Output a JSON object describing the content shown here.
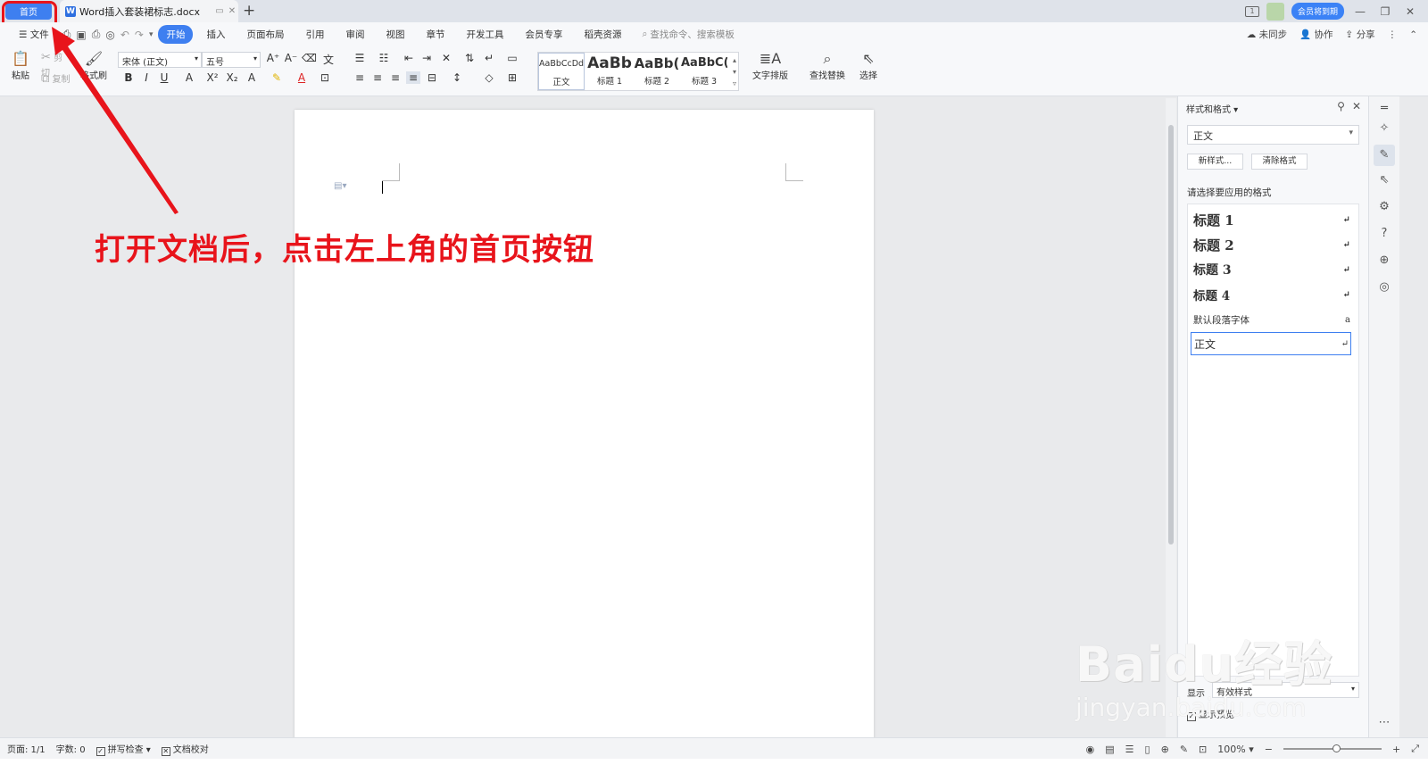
{
  "titlebar": {
    "home_tab": "首页",
    "doc_tab": "Word插入套装裙标志.docx",
    "member_badge": "会员将到期"
  },
  "menu": {
    "file": "文件",
    "tabs": [
      "开始",
      "插入",
      "页面布局",
      "引用",
      "审阅",
      "视图",
      "章节",
      "开发工具",
      "会员专享",
      "稻壳资源"
    ],
    "active_tab": "开始",
    "search_placeholder": "查找命令、搜索模板",
    "right": [
      "未同步",
      "协作",
      "分享"
    ]
  },
  "toolbar": {
    "paste": "粘贴",
    "cut": "剪切",
    "copy": "复制",
    "format_painter": "格式刷",
    "font": "宋体 (正文)",
    "size": "五号",
    "styles": [
      {
        "sample": "AaBbCcDd",
        "name": "正文"
      },
      {
        "sample": "AaBb",
        "name": "标题 1"
      },
      {
        "sample": "AaBb(",
        "name": "标题 2"
      },
      {
        "sample": "AaBbC(",
        "name": "标题 3"
      }
    ],
    "text_layout": "文字排版",
    "find_replace": "查找替换",
    "select": "选择"
  },
  "annotation": "打开文档后，点击左上角的首页按钮",
  "panel": {
    "title": "样式和格式",
    "current_style": "正文",
    "new_style": "新样式...",
    "clear_format": "清除格式",
    "hint": "请选择要应用的格式",
    "items": [
      "标题 1",
      "标题 2",
      "标题 3",
      "标题 4",
      "默认段落字体",
      "正文"
    ],
    "show_label": "显示",
    "show_value": "有效样式",
    "preview": "显示预览"
  },
  "status": {
    "page": "页面: 1/1",
    "words": "字数: 0",
    "spell": "拼写检查",
    "proof": "文档校对",
    "zoom": "100%"
  },
  "watermark": {
    "main": "Baidu经验",
    "sub": "jingyan.baidu.com"
  },
  "colors": {
    "accent": "#3e7ff0",
    "annotation": "#e8141b"
  }
}
